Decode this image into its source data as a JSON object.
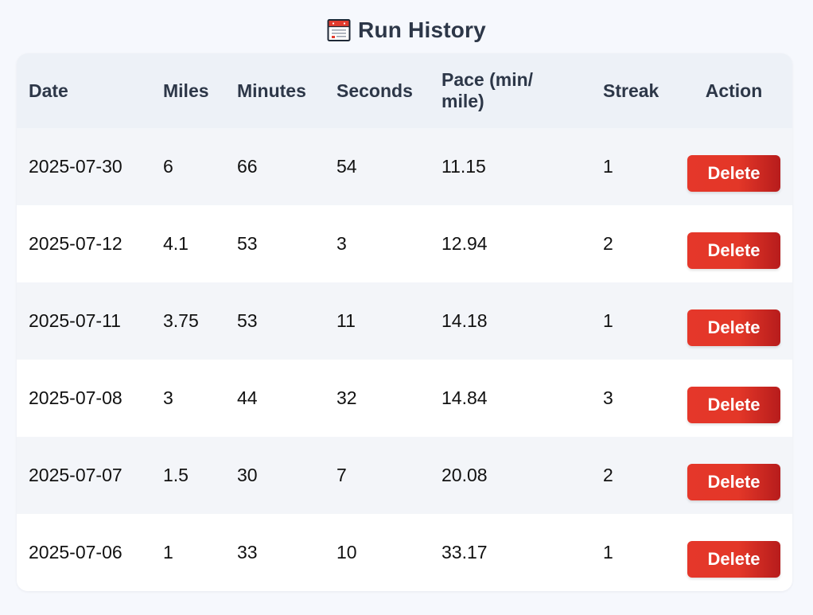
{
  "header": {
    "title": "Run History",
    "icon": "calendar-icon"
  },
  "table": {
    "columns": {
      "date": "Date",
      "miles": "Miles",
      "minutes": "Minutes",
      "seconds": "Seconds",
      "pace": "Pace (min/ mile)",
      "streak": "Streak",
      "action": "Action"
    },
    "rows": [
      {
        "date": "2025-07-30",
        "miles": "6",
        "minutes": "66",
        "seconds": "54",
        "pace": "11.15",
        "streak": "1",
        "action": "Delete"
      },
      {
        "date": "2025-07-12",
        "miles": "4.1",
        "minutes": "53",
        "seconds": "3",
        "pace": "12.94",
        "streak": "2",
        "action": "Delete"
      },
      {
        "date": "2025-07-11",
        "miles": "3.75",
        "minutes": "53",
        "seconds": "11",
        "pace": "14.18",
        "streak": "1",
        "action": "Delete"
      },
      {
        "date": "2025-07-08",
        "miles": "3",
        "minutes": "44",
        "seconds": "32",
        "pace": "14.84",
        "streak": "3",
        "action": "Delete"
      },
      {
        "date": "2025-07-07",
        "miles": "1.5",
        "minutes": "30",
        "seconds": "7",
        "pace": "20.08",
        "streak": "2",
        "action": "Delete"
      },
      {
        "date": "2025-07-06",
        "miles": "1",
        "minutes": "33",
        "seconds": "10",
        "pace": "33.17",
        "streak": "1",
        "action": "Delete"
      }
    ]
  },
  "colors": {
    "page_background": "#f6f8fd",
    "header_background": "#edf1f7",
    "stripe_background": "#f3f5f9",
    "heading_text": "#2d3748",
    "delete_button": "#e5372a",
    "delete_button_dark": "#b71c1c"
  }
}
